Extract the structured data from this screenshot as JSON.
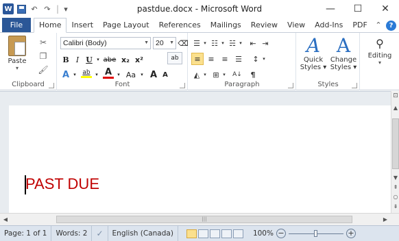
{
  "window": {
    "title": "pastdue.docx - Microsoft Word",
    "app_logo": "W",
    "minimize": "—",
    "maximize": "☐",
    "close": "✕"
  },
  "qat": {
    "undo_icon": "↶",
    "redo_icon": "↷",
    "dropdown_icon": "▾"
  },
  "tabs": [
    {
      "label": "File"
    },
    {
      "label": "Home"
    },
    {
      "label": "Insert"
    },
    {
      "label": "Page Layout"
    },
    {
      "label": "References"
    },
    {
      "label": "Mailings"
    },
    {
      "label": "Review"
    },
    {
      "label": "View"
    },
    {
      "label": "Add-Ins"
    },
    {
      "label": "PDF"
    }
  ],
  "active_tab": "Home",
  "ribbon": {
    "clipboard": {
      "label": "Clipboard",
      "paste": "Paste"
    },
    "font": {
      "label": "Font",
      "font_name": "Calibri (Body)",
      "font_size": "20",
      "bold": "B",
      "italic": "I",
      "underline": "U",
      "strikethrough": "abe",
      "subscript": "x₂",
      "superscript": "x²",
      "change_case": "Aa",
      "grow": "A",
      "shrink": "A",
      "font_color_letter": "A",
      "highlight_letter": "ab"
    },
    "paragraph": {
      "label": "Paragraph",
      "pilcrow": "¶"
    },
    "styles": {
      "label": "Styles",
      "quick_styles_line1": "Quick",
      "quick_styles_line2": "Styles ▾",
      "change_styles_line1": "Change",
      "change_styles_line2": "Styles ▾"
    },
    "editing": {
      "label": "Editing"
    }
  },
  "document": {
    "text": "PAST DUE",
    "text_color": "#c00000"
  },
  "statusbar": {
    "page": "Page: 1 of 1",
    "words": "Words: 2",
    "language": "English (Canada)",
    "zoom": "100%",
    "zoom_level": 100
  },
  "colors": {
    "file_tab": "#2b5797",
    "accent": "#2b579a",
    "statusbar": "#dce4ee"
  }
}
